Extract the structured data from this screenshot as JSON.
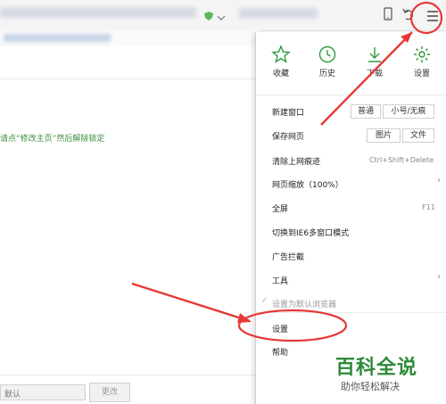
{
  "page": {
    "notice_text": "请点“修改主页”然后解除锁定",
    "bottom_input_value": "默认",
    "bottom_button_label": "更改"
  },
  "menu": {
    "quick_items": [
      {
        "label": "收藏",
        "icon": "star-icon"
      },
      {
        "label": "历史",
        "icon": "clock-icon"
      },
      {
        "label": "下载",
        "icon": "download-icon"
      },
      {
        "label": "设置",
        "icon": "gear-icon"
      }
    ],
    "new_window": {
      "label": "新建窗口",
      "btn_normal": "普通",
      "btn_small": "小号/无痕"
    },
    "save_page": {
      "label": "保存网页",
      "btn_image": "图片",
      "btn_file": "文件"
    },
    "clear_traces": {
      "label": "清除上网痕迹",
      "shortcut": "Ctrl+Shift+Delete"
    },
    "zoom": {
      "label": "网页缩放（100%）"
    },
    "fullscreen": {
      "label": "全屏",
      "shortcut": "F11"
    },
    "ie6_mode": {
      "label": "切换到IE6多窗口模式"
    },
    "ad_block": {
      "label": "广告拦截"
    },
    "tools": {
      "label": "工具"
    },
    "default_browser": {
      "label": "设置为默认浏览器"
    },
    "settings": {
      "label": "设置"
    },
    "help": {
      "label": "帮助"
    }
  },
  "watermark": {
    "title": "百科全说",
    "subtitle": "助你轻松解决"
  },
  "colors": {
    "accent_green": "#2f9a3c",
    "annotation_red": "#e53935"
  }
}
